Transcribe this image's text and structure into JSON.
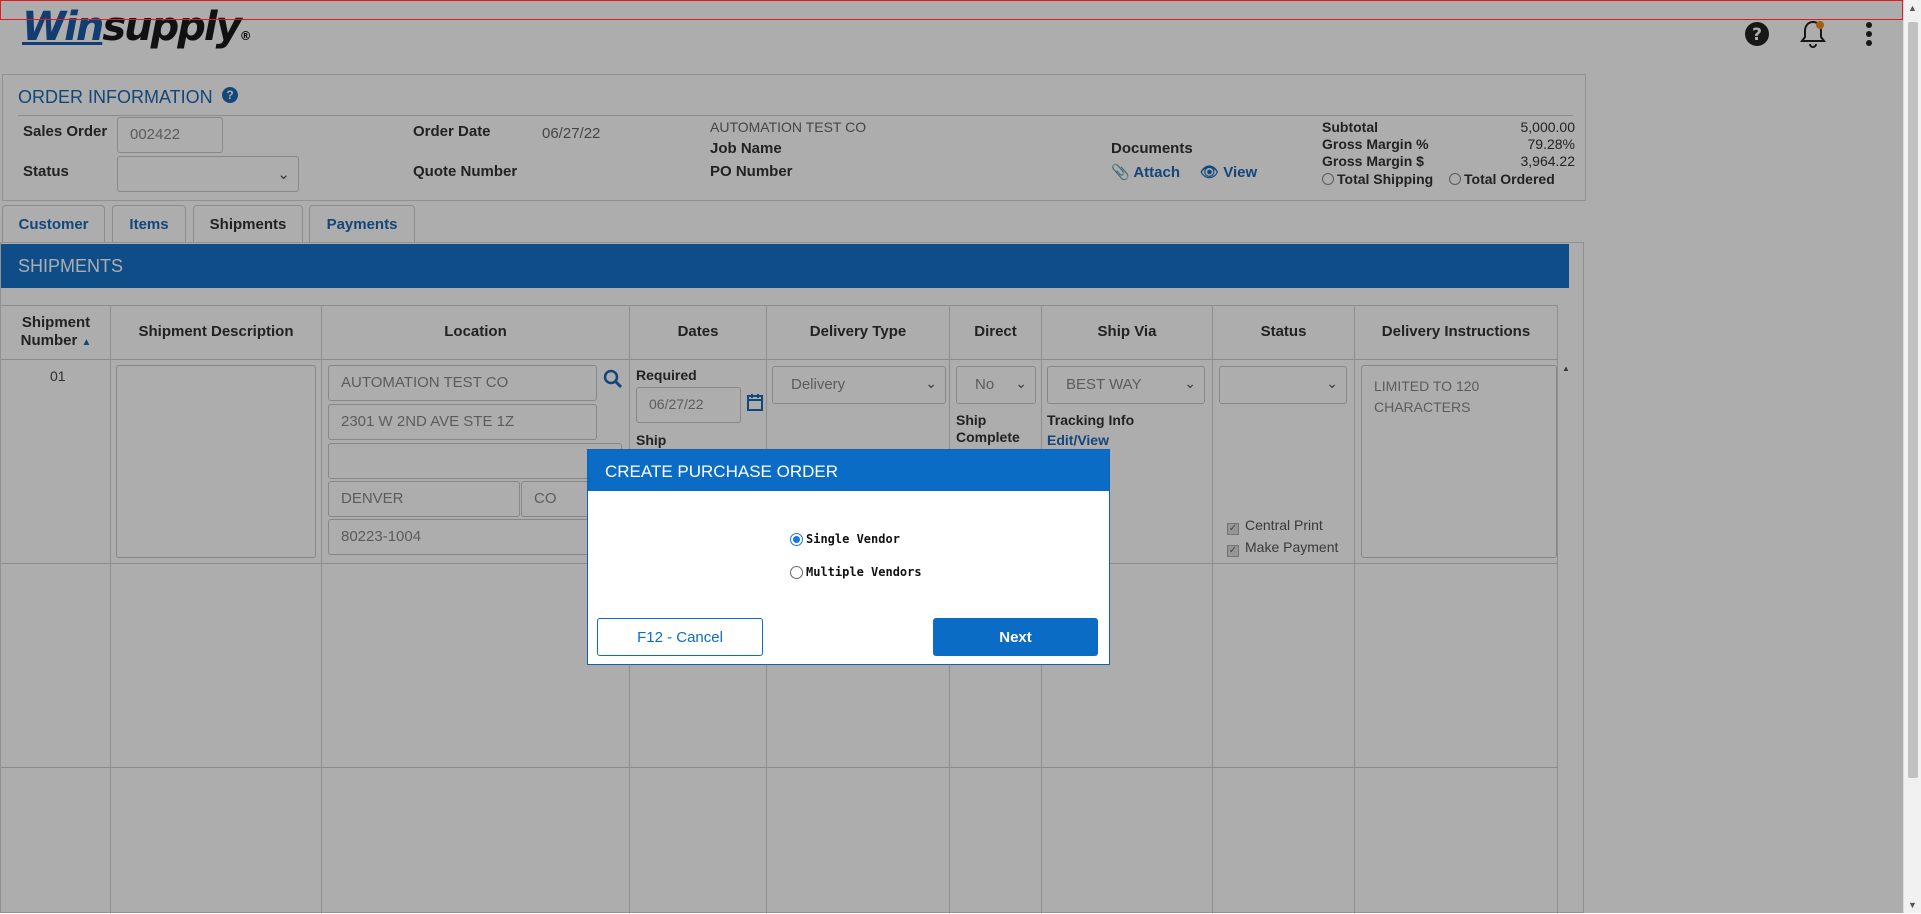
{
  "header": {
    "logo_win": "Win",
    "logo_supply": "supply",
    "logo_reg": "®",
    "icons": [
      "help-icon",
      "bell-icon",
      "more-vert-icon"
    ]
  },
  "order_info": {
    "title": "ORDER INFORMATION",
    "sales_order_label": "Sales Order",
    "sales_order_value": "002422",
    "status_label": "Status",
    "status_value": "",
    "order_date_label": "Order Date",
    "order_date_value": "06/27/22",
    "quote_number_label": "Quote Number",
    "customer_name": "AUTOMATION TEST CO",
    "job_name_label": "Job Name",
    "po_number_label": "PO Number",
    "documents_label": "Documents",
    "attach_label": "Attach",
    "view_label": "View",
    "subtotal_label": "Subtotal",
    "subtotal_value": "5,000.00",
    "gm_pct_label": "Gross Margin %",
    "gm_pct_value": "79.28%",
    "gm_dollar_label": "Gross Margin $",
    "gm_dollar_value": "3,964.22",
    "total_shipping_label": "Total Shipping",
    "total_ordered_label": "Total Ordered"
  },
  "tabs": [
    {
      "label": "Customer"
    },
    {
      "label": "Items"
    },
    {
      "label": "Shipments"
    },
    {
      "label": "Payments"
    }
  ],
  "shipments": {
    "title": "SHIPMENTS",
    "columns": {
      "number_line1": "Shipment",
      "number_line2": "Number",
      "description": "Shipment Description",
      "location": "Location",
      "dates": "Dates",
      "delivery_type": "Delivery Type",
      "direct": "Direct",
      "ship_via": "Ship Via",
      "status": "Status",
      "instructions": "Delivery Instructions"
    },
    "row": {
      "number": "01",
      "loc_name": "AUTOMATION TEST CO",
      "loc_address": "2301 W 2ND AVE STE 1Z",
      "loc_address2": "",
      "loc_city": "DENVER",
      "loc_state": "CO",
      "loc_zip": "80223-1004",
      "required_label": "Required",
      "required_date": "06/27/22",
      "ship_label": "Ship",
      "delivery_type": "Delivery",
      "direct": "No",
      "ship_complete_line1": "Ship",
      "ship_complete_line2": "Complete",
      "ship_via": "BEST WAY",
      "tracking_label": "Tracking Info",
      "edit_view_label": "Edit/View",
      "central_print_label": "Central Print",
      "make_payment_label": "Make Payment",
      "instructions_placeholder": "LIMITED TO 120 CHARACTERS"
    }
  },
  "modal": {
    "title": "CREATE PURCHASE ORDER",
    "option_single": "Single Vendor",
    "option_multiple": "Multiple Vendors",
    "selected": "single",
    "cancel_label": "F12 - Cancel",
    "next_label": "Next"
  },
  "colors": {
    "brand_blue": "#1c67b6",
    "bar_blue": "#1572c9",
    "modal_blue": "#0b6cc6"
  }
}
